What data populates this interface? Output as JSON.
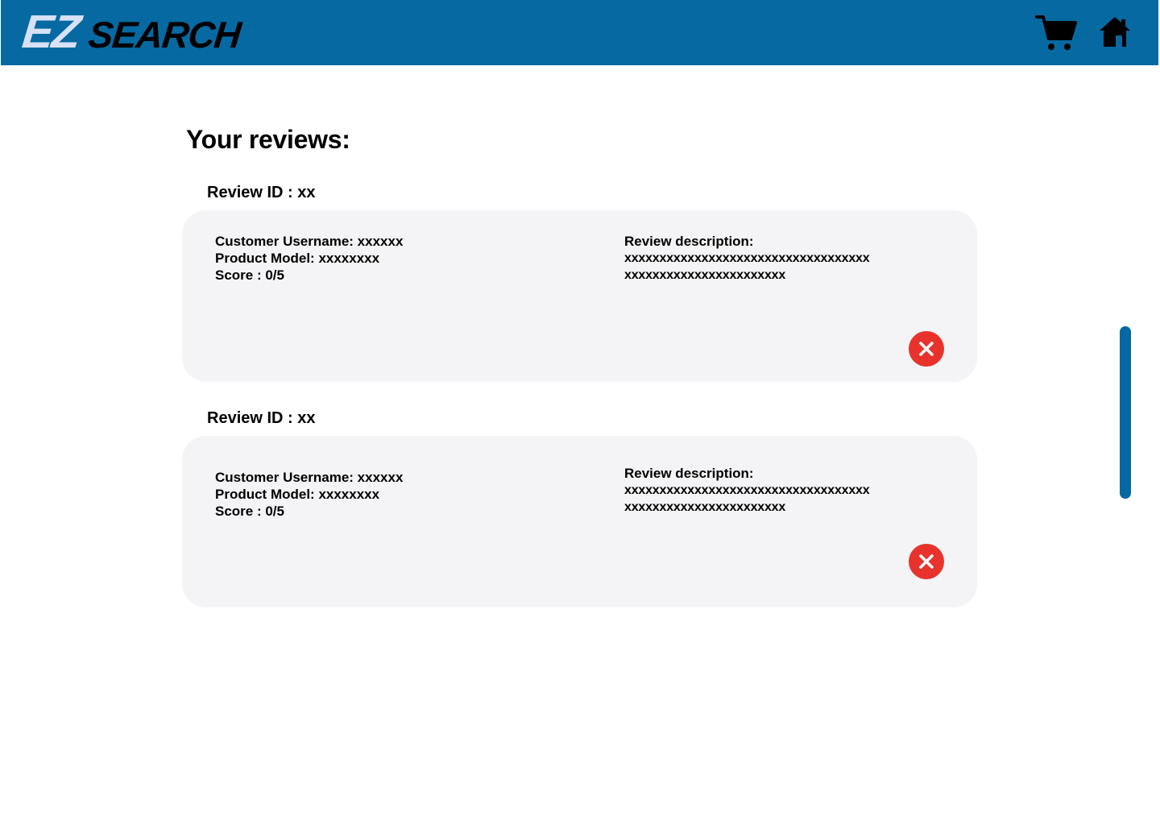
{
  "header": {
    "logo_ez": "EZ",
    "logo_search": "SEARCH",
    "background_color": "#0669a1",
    "icons": [
      "cart-icon",
      "home-icon"
    ]
  },
  "main": {
    "title": "Your reviews:",
    "reviews": [
      {
        "id_label": "Review ID : xx",
        "customer_username": "Customer Username: xxxxxx",
        "product_model": "Product Model: xxxxxxxx",
        "score": "Score : 0/5",
        "description_label": "Review description:",
        "description_line1": "xxxxxxxxxxxxxxxxxxxxxxxxxxxxxxxxxxx",
        "description_line2": "xxxxxxxxxxxxxxxxxxxxxxx"
      },
      {
        "id_label": "Review ID : xx",
        "customer_username": "Customer Username: xxxxxx",
        "product_model": "Product Model: xxxxxxxx",
        "score": "Score : 0/5",
        "description_label": "Review description:",
        "description_line1": "xxxxxxxxxxxxxxxxxxxxxxxxxxxxxxxxxxx",
        "description_line2": "xxxxxxxxxxxxxxxxxxxxxxx"
      }
    ]
  },
  "colors": {
    "card_background": "#f4f4f6",
    "delete_button": "#e8332c",
    "scrollbar": "#0669a1"
  }
}
